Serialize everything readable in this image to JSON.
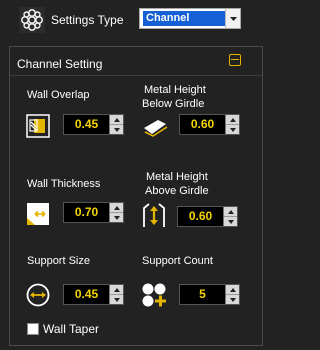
{
  "header": {
    "settings_type_label": "Settings Type",
    "settings_type_value": "Channel",
    "app_icon": "gear-pattern-icon"
  },
  "panel": {
    "title": "Channel Setting",
    "collapse_icon": "collapse-icon",
    "fields": {
      "wall_overlap": {
        "label": "Wall Overlap",
        "value": "0.45",
        "icon": "wall-overlap-icon"
      },
      "metal_height_below_girdle": {
        "label_line1": "Metal  Height",
        "label_line2": "Below Girdle",
        "value": "0.60",
        "icon": "metal-below-girdle-icon"
      },
      "wall_thickness": {
        "label": "Wall Thickness",
        "value": "0.70",
        "icon": "wall-thickness-icon"
      },
      "metal_height_above_girdle": {
        "label_line1": "Metal  Height",
        "label_line2": "Above  Girdle",
        "value": "0.60",
        "icon": "metal-above-girdle-icon"
      },
      "support_size": {
        "label": "Support Size",
        "value": "0.45",
        "icon": "support-size-icon"
      },
      "support_count": {
        "label": "Support Count",
        "value": "5",
        "icon": "support-count-icon"
      }
    },
    "wall_taper": {
      "label": "Wall Taper",
      "checked": false
    }
  },
  "colors": {
    "background": "#222222",
    "accent_yellow": "#f4d400",
    "selection_blue": "#1660d6"
  }
}
